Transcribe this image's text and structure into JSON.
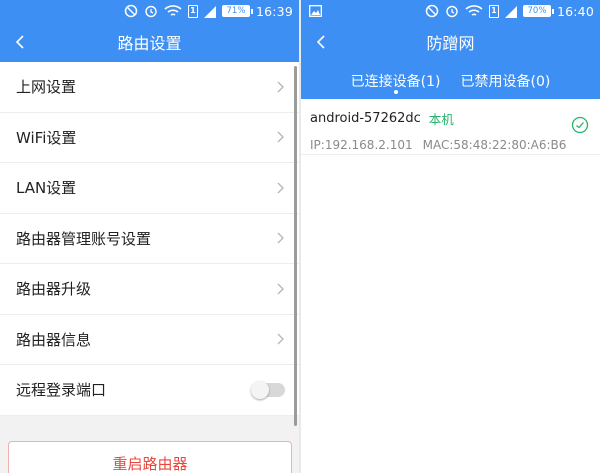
{
  "left": {
    "status": {
      "time": "16:39",
      "battery": "71%",
      "sim": "1"
    },
    "title": "路由设置",
    "menu": [
      {
        "label": "上网设置"
      },
      {
        "label": "WiFi设置"
      },
      {
        "label": "LAN设置"
      },
      {
        "label": "路由器管理账号设置"
      },
      {
        "label": "路由器升级"
      },
      {
        "label": "路由器信息"
      }
    ],
    "remote_login": {
      "label": "远程登录端口",
      "enabled": false
    },
    "reboot_label": "重启路由器"
  },
  "right": {
    "status": {
      "time": "16:40",
      "battery": "70%",
      "sim": "1"
    },
    "title": "防蹭网",
    "tabs": [
      {
        "label": "已连接设备(1)",
        "active": true
      },
      {
        "label": "已禁用设备(0)",
        "active": false
      }
    ],
    "devices": [
      {
        "name": "android-57262dc",
        "tag": "本机",
        "ip": "IP:192.168.2.101",
        "mac": "MAC:58:48:22:80:A6:B6"
      }
    ]
  },
  "colors": {
    "accent": "#3d8ff3",
    "danger": "#e8473d",
    "success": "#27b36b"
  }
}
